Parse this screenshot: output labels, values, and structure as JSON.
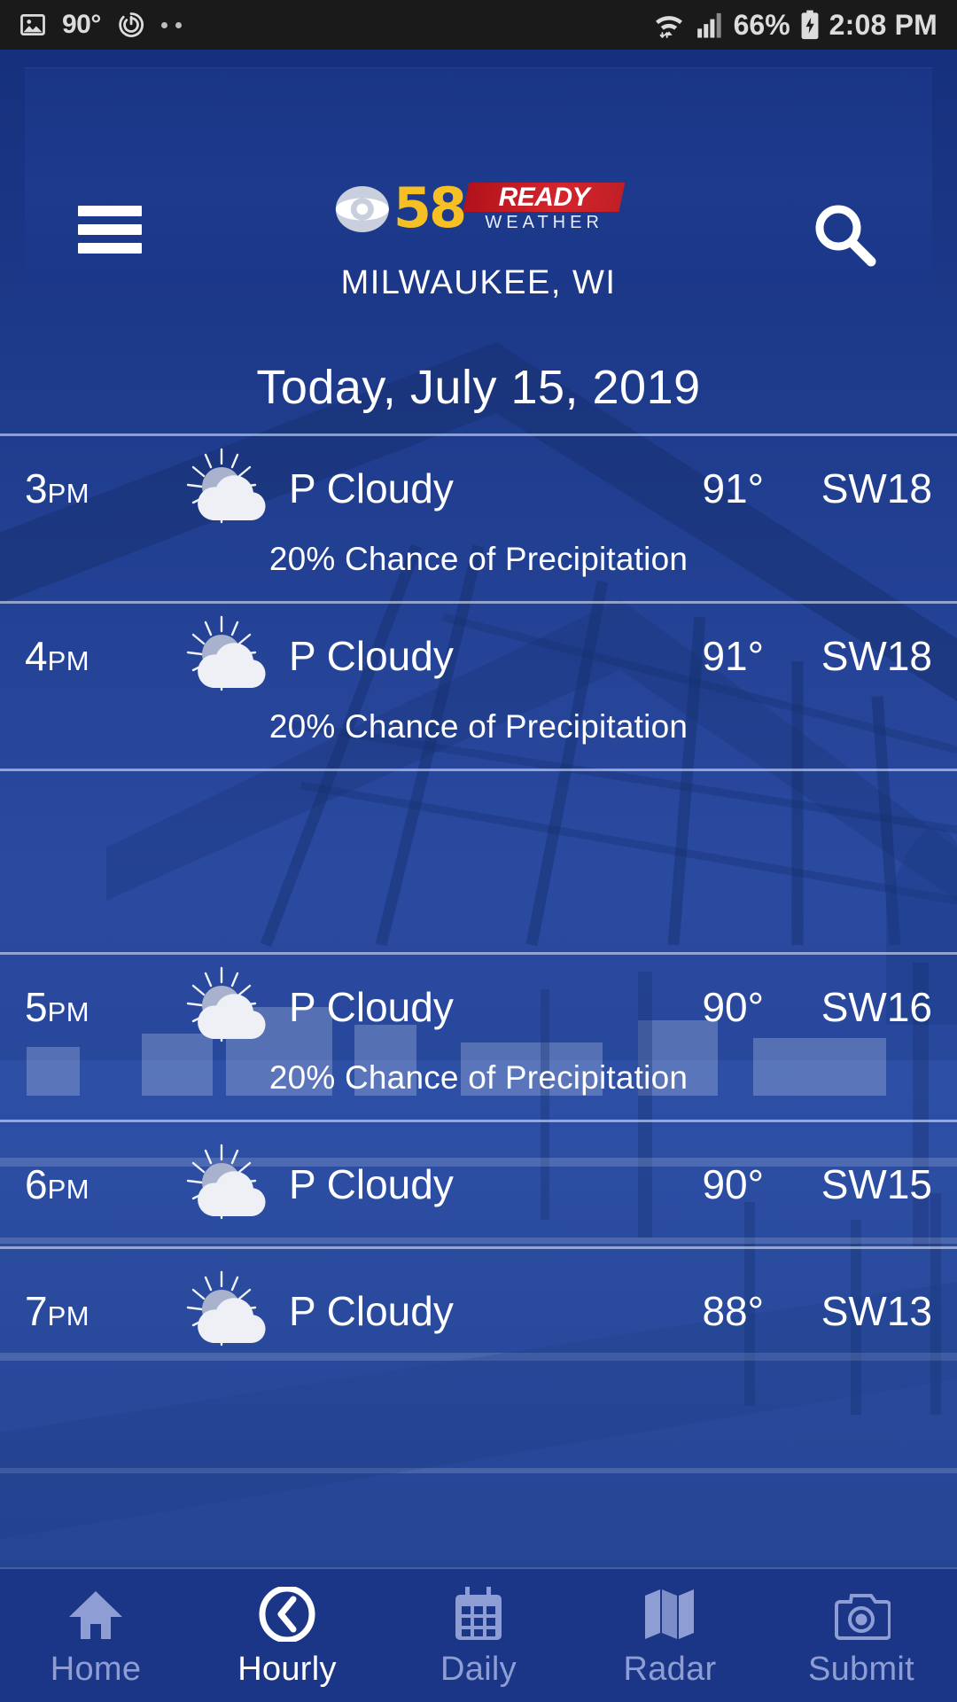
{
  "status_bar": {
    "image_icon": "photo-icon",
    "temperature": "90°",
    "screen_record_icon": "screen-record-icon",
    "dots_icon": "more-dots-icon",
    "wifi_icon": "wifi-icon",
    "signal_icon": "cell-signal-icon",
    "battery_percent": "66%",
    "battery_icon": "battery-charging-icon",
    "time": "2:08 PM"
  },
  "header": {
    "menu_icon": "hamburger-menu-icon",
    "search_icon": "search-icon",
    "logo": {
      "eye_icon": "cbs-eye-icon",
      "channel": "58",
      "ready": "READY",
      "weather": "WEATHER"
    },
    "location": "MILWAUKEE, WI"
  },
  "page": {
    "date_title": "Today, July 15, 2019"
  },
  "colors": {
    "brand_blue": "#1b3687",
    "header_blue": "#1a3585",
    "logo_yellow": "#f6c024",
    "logo_red": "#c01f26",
    "divider": "#d7def0",
    "nav_inactive": "#8e9ed4",
    "nav_active": "#ffffff",
    "status_bar_bg": "#1a1a1a"
  },
  "forecast": {
    "rows": [
      {
        "time": "3",
        "ampm": "PM",
        "icon": "partly-cloudy-icon",
        "condition": "P Cloudy",
        "temp": "91°",
        "wind": "SW18",
        "precip": "20% Chance of Precipitation"
      },
      {
        "time": "4",
        "ampm": "PM",
        "icon": "partly-cloudy-icon",
        "condition": "P Cloudy",
        "temp": "91°",
        "wind": "SW18",
        "precip": "20% Chance of Precipitation"
      },
      {
        "time": "5",
        "ampm": "PM",
        "icon": "partly-cloudy-icon",
        "condition": "P Cloudy",
        "temp": "90°",
        "wind": "SW16",
        "precip": "20% Chance of Precipitation"
      },
      {
        "time": "6",
        "ampm": "PM",
        "icon": "partly-cloudy-icon",
        "condition": "P Cloudy",
        "temp": "90°",
        "wind": "SW15",
        "precip": ""
      },
      {
        "time": "7",
        "ampm": "PM",
        "icon": "partly-cloudy-icon",
        "condition": "P Cloudy",
        "temp": "88°",
        "wind": "SW13",
        "precip": ""
      }
    ]
  },
  "bottom_nav": {
    "items": [
      {
        "label": "Home",
        "icon": "home-icon",
        "active": false
      },
      {
        "label": "Hourly",
        "icon": "clock-icon",
        "active": true
      },
      {
        "label": "Daily",
        "icon": "calendar-icon",
        "active": false
      },
      {
        "label": "Radar",
        "icon": "map-icon",
        "active": false
      },
      {
        "label": "Submit",
        "icon": "camera-icon",
        "active": false
      }
    ]
  }
}
